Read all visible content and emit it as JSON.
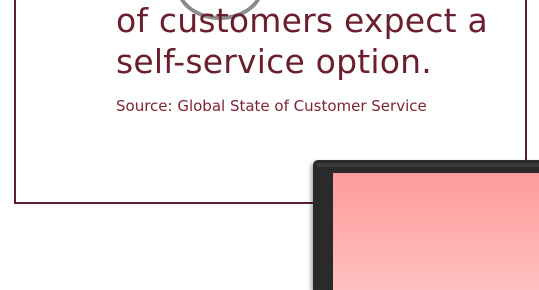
{
  "headline": {
    "line1": "of customers expect a",
    "line2": "self-service option."
  },
  "source": {
    "text": "Source: Global State of Customer Service"
  },
  "colors": {
    "accent": "#6b1f2e",
    "border": "#5a1f2a",
    "screen": "#ffa3a3"
  }
}
